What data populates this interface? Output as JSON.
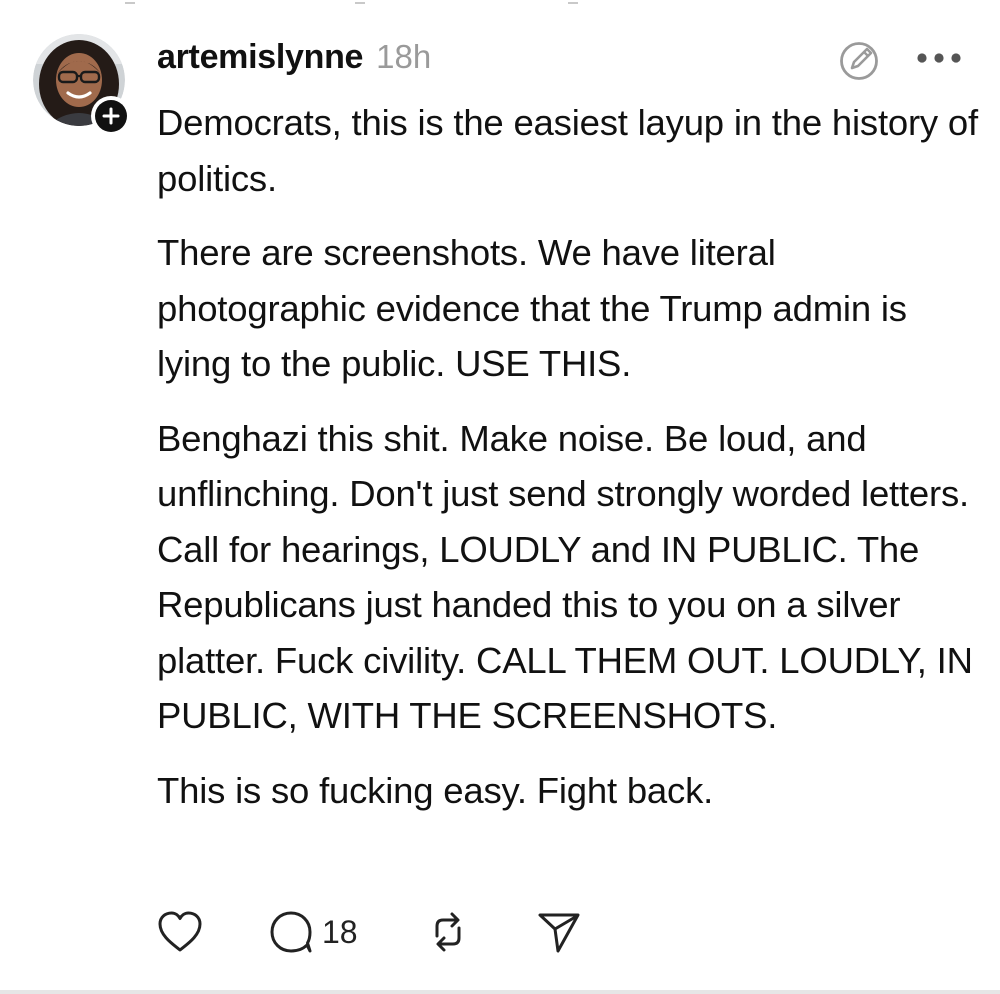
{
  "post": {
    "username": "artemislynne",
    "timestamp": "18h",
    "paragraphs": [
      "Democrats, this is the easiest layup in the history of politics.",
      "There are screenshots. We have literal photographic evidence that the Trump admin is lying to the public. USE THIS.",
      "Benghazi this shit. Make noise. Be loud, and unflinching. Don't just send strongly worded letters. Call for hearings, LOUDLY and IN PUBLIC. The Republicans just handed this to you on a silver platter. Fuck civility. CALL THEM OUT. LOUDLY, IN PUBLIC, WITH THE SCREENSHOTS.",
      "This is so fucking easy. Fight back."
    ]
  },
  "actions": {
    "reply_count": "18"
  },
  "icons": {
    "follow": "plus-icon",
    "edit": "edit-icon",
    "more": "more-icon",
    "like": "heart-icon",
    "reply": "comment-icon",
    "repost": "repost-icon",
    "share": "send-icon"
  },
  "colors": {
    "text": "#111111",
    "muted": "#9a9a9a",
    "icon": "#222222",
    "background": "#ffffff"
  }
}
